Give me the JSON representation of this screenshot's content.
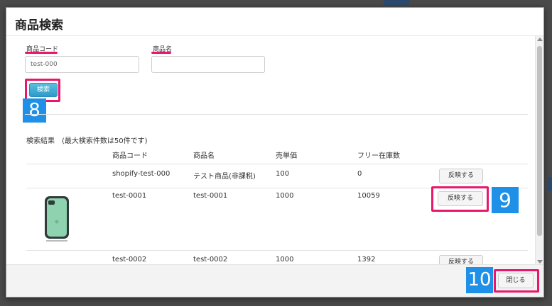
{
  "modal": {
    "title": "商品検索"
  },
  "form": {
    "code_label": "商品コード",
    "code_value": "test-000",
    "name_label": "商品名",
    "name_value": "",
    "search_label": "検索"
  },
  "results": {
    "title": "検索結果　(最大検索件数は50件です)",
    "columns": [
      "商品コード",
      "商品名",
      "売単価",
      "フリー在庫数"
    ],
    "rows": [
      {
        "code": "shopify-test-000",
        "name": "テスト商品(非課税)",
        "price": "100",
        "stock": "0",
        "action": "反映する"
      },
      {
        "code": "test-0001",
        "name": "test-0001",
        "price": "1000",
        "stock": "10059",
        "action": "反映する"
      },
      {
        "code": "test-0002",
        "name": "test-0002",
        "price": "1000",
        "stock": "1392",
        "action": "反映する"
      }
    ]
  },
  "callouts": {
    "search": "8",
    "reflect": "9",
    "close": "10"
  },
  "footer": {
    "close_label": "閉じる"
  },
  "colors": {
    "accent_pink": "#e8176b",
    "callout_blue": "#1e90e8",
    "search_button": "#2e9ac8"
  }
}
